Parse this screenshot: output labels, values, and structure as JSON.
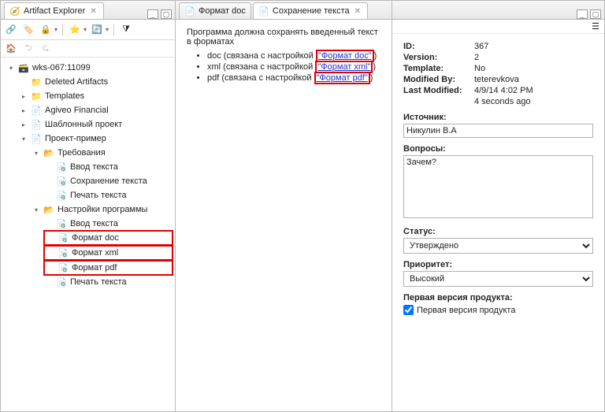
{
  "leftPane": {
    "title": "Artifact Explorer",
    "tree": {
      "root": "wks-067:11099",
      "deleted": "Deleted Artifacts",
      "templates": "Templates",
      "agiveo": "Agiveo Financial",
      "shablon": "Шаблонный проект",
      "project": "Проект-пример",
      "req": "Требования",
      "vvod1": "Ввод текста",
      "sokhr": "Сохранение текста",
      "pech1": "Печать текста",
      "nast": "Настройки программы",
      "vvod2": "Ввод текста",
      "fmtDoc": "Формат doc",
      "fmtXml": "Формат xml",
      "fmtPdf": "Формат pdf",
      "pech2": "Печать текста"
    }
  },
  "midPane": {
    "tabs": {
      "t1": "Формат doc",
      "t2": "Сохранение текста"
    },
    "text1": "Программа должна сохранять введенный текст в форматах",
    "li1_pre": "doc (связана с настройкой ",
    "li1_link": "\"Формат doc\"",
    "li1_post": ")",
    "li2_pre": "xml (связана с настройкой ",
    "li2_link": "\"Формат xml\"",
    "li2_post": ")",
    "li3_pre": "pdf (связана с настройкой ",
    "li3_link": "\"Формат pdf\"",
    "li3_post": ")"
  },
  "rightPane": {
    "idLabel": "ID:",
    "idVal": "367",
    "verLabel": "Version:",
    "verVal": "2",
    "tplLabel": "Template:",
    "tplVal": "No",
    "modByLabel": "Modified By:",
    "modByVal": "teterevkova",
    "lastModLabel": "Last Modified:",
    "lastModVal": "4/9/14 4:02 PM",
    "agoVal": "4 seconds ago",
    "srcLabel": "Источник:",
    "srcVal": "Никулин В.А",
    "qLabel": "Вопросы:",
    "qVal": "Зачем?",
    "statusLabel": "Статус:",
    "statusVal": "Утверждено",
    "prioLabel": "Приоритет:",
    "prioVal": "Высокий",
    "firstVerLabel": "Первая версия продукта:",
    "firstVerChk": "Первая версия продукта"
  }
}
